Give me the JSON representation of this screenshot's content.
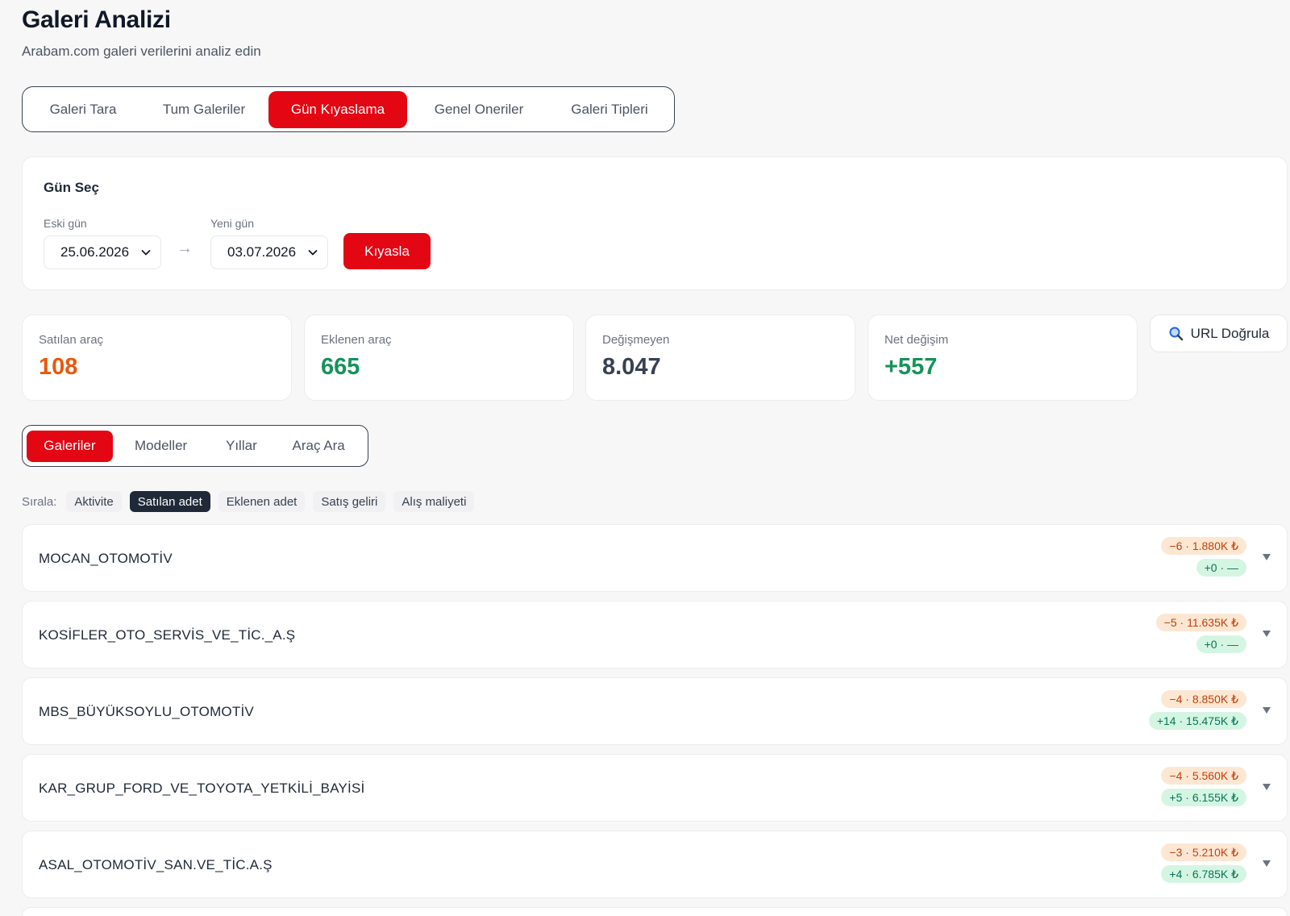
{
  "header": {
    "title": "Galeri Analizi",
    "subtitle": "Arabam.com galeri verilerini analiz edin"
  },
  "main_tabs": [
    {
      "label": "Galeri Tara",
      "active": false
    },
    {
      "label": "Tum Galeriler",
      "active": false
    },
    {
      "label": "Gün Kıyaslama",
      "active": true
    },
    {
      "label": "Genel Oneriler",
      "active": false
    },
    {
      "label": "Galeri Tipleri",
      "active": false
    }
  ],
  "day_select": {
    "title": "Gün Seç",
    "old_label": "Eski gün",
    "old_value": "25.06.2026",
    "arrow": "→",
    "new_label": "Yeni gün",
    "new_value": "03.07.2026",
    "compare_label": "Kıyasla"
  },
  "stats": [
    {
      "label": "Satılan araç",
      "value": "108",
      "color": "#ea580c"
    },
    {
      "label": "Eklenen araç",
      "value": "665",
      "color": "#15935b"
    },
    {
      "label": "Değişmeyen",
      "value": "8.047",
      "color": "#374151"
    },
    {
      "label": "Net değişim",
      "value": "+557",
      "color": "#15935b"
    }
  ],
  "url_check": {
    "label": "URL Doğrula",
    "icon": "magnifier-icon"
  },
  "sub_tabs": [
    {
      "label": "Galeriler",
      "active": true
    },
    {
      "label": "Modeller",
      "active": false
    },
    {
      "label": "Yıllar",
      "active": false
    },
    {
      "label": "Araç Ara",
      "active": false
    }
  ],
  "sort": {
    "label": "Sırala:",
    "options": [
      {
        "label": "Aktivite",
        "active": false
      },
      {
        "label": "Satılan adet",
        "active": true
      },
      {
        "label": "Eklenen adet",
        "active": false
      },
      {
        "label": "Satış geliri",
        "active": false
      },
      {
        "label": "Alış maliyeti",
        "active": false
      }
    ]
  },
  "galleries": [
    {
      "name": "MOCAN_OTOMOTİV",
      "sold": "−6 · 1.880K ₺",
      "added": "+0 · —"
    },
    {
      "name": "KOSİFLER_OTO_SERVİS_VE_TİC._A.Ş",
      "sold": "−5 · 11.635K ₺",
      "added": "+0 · —"
    },
    {
      "name": "MBS_BÜYÜKSOYLU_OTOMOTİV",
      "sold": "−4 · 8.850K ₺",
      "added": "+14 · 15.475K ₺"
    },
    {
      "name": "KAR_GRUP_FORD_VE_TOYOTA_YETKİLİ_BAYİSİ",
      "sold": "−4 · 5.560K ₺",
      "added": "+5 · 6.155K ₺"
    },
    {
      "name": "ASAL_OTOMOTİV_SAN.VE_TİC.A.Ş",
      "sold": "−3 · 5.210K ₺",
      "added": "+4 · 6.785K ₺"
    }
  ],
  "colors": {
    "accent": "#e30613",
    "dark": "#1f2937",
    "neg_bg": "#fde7d3",
    "neg_fg": "#c2410c",
    "pos_bg": "#d5f5e3",
    "pos_fg": "#047857"
  }
}
